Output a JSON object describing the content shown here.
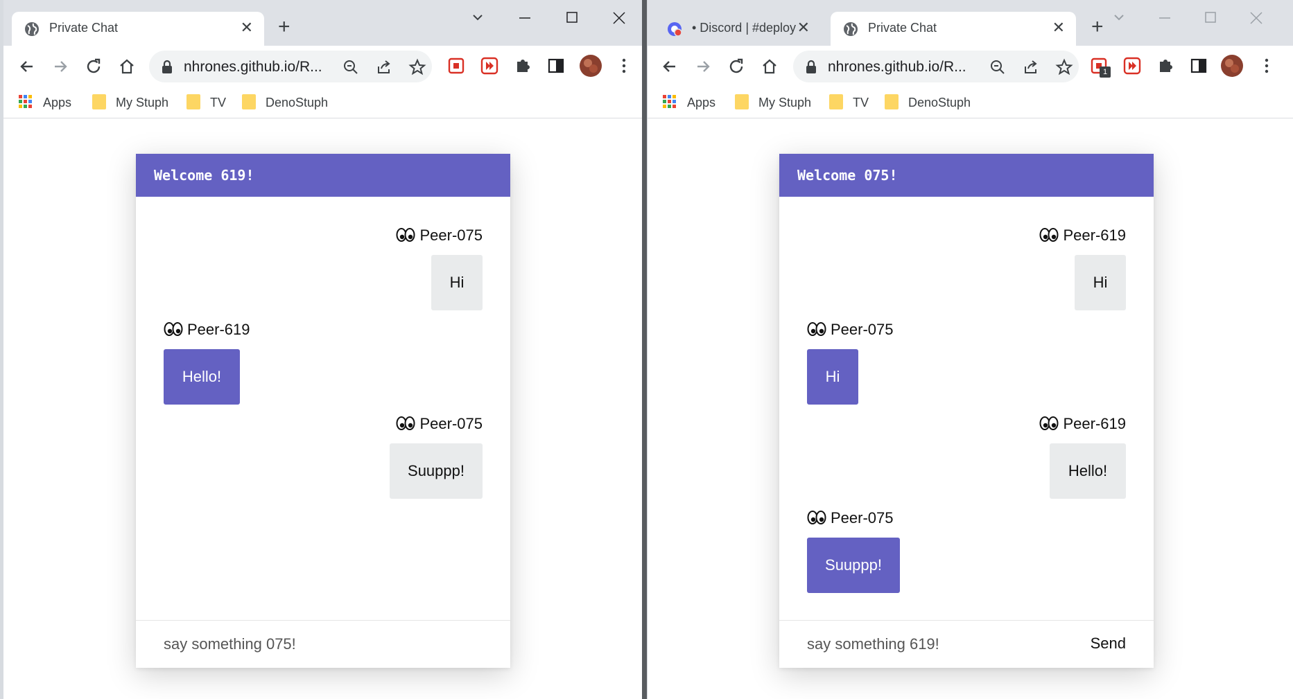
{
  "left": {
    "tab": {
      "title": "Private Chat",
      "close": "✕"
    },
    "new_tab": "+",
    "url": "nhrones.github.io/R...",
    "bookmarks": [
      "Apps",
      "My Stuph",
      "TV",
      "DenoStuph"
    ],
    "chat": {
      "header": "Welcome 619!",
      "messages": [
        {
          "peer": "Peer-075",
          "text": "Hi"
        },
        {
          "peer": "Peer-619",
          "text": "Hello!"
        },
        {
          "peer": "Peer-075",
          "text": "Suuppp!"
        }
      ],
      "input_placeholder": "say something 075!"
    }
  },
  "right": {
    "tabs": [
      {
        "title": "• Discord | #deploy",
        "close": "✕"
      },
      {
        "title": "Private Chat",
        "close": "✕"
      }
    ],
    "new_tab": "+",
    "url": "nhrones.github.io/R...",
    "extension_badge": "1",
    "bookmarks": [
      "Apps",
      "My Stuph",
      "TV",
      "DenoStuph"
    ],
    "chat": {
      "header": "Welcome 075!",
      "messages": [
        {
          "peer": "Peer-619",
          "text": "Hi"
        },
        {
          "peer": "Peer-075",
          "text": "Hi"
        },
        {
          "peer": "Peer-619",
          "text": "Hello!"
        },
        {
          "peer": "Peer-075",
          "text": "Suuppp!"
        }
      ],
      "input_placeholder": "say something 619!",
      "send_label": "Send"
    }
  },
  "colors": {
    "accent": "#6461c2",
    "bubble_other": "#e9ebec",
    "chrome_frame": "#dee1e6"
  }
}
